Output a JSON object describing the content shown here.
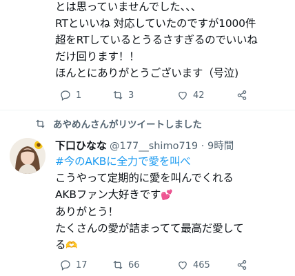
{
  "prev_tweet": {
    "lines": [
      "とは思っていませんでした、、、",
      "RTといいね 対応していたのですが1000件",
      "超をRTしているとうるさすぎるのでいいね",
      "だけ回ります！！",
      "ほんとにありがとうございます（号泣)"
    ],
    "actions": {
      "reply_count": "1",
      "retweet_count": "3",
      "like_count": "42"
    }
  },
  "retweet_header": {
    "text": "あやめんさんがリツイートしました"
  },
  "tweet": {
    "display_name": "下口ひなな",
    "handle_time": "@177__shimo719 · 9時間",
    "hashtag": "#今のAKBに全力で愛を叫べ",
    "line1": "こうやって定期的に愛を叫んでくれる",
    "line2": "AKBファン大好きです",
    "line2_emoji": "💕",
    "line3": "ありがとう！",
    "line4": "たくさんの愛が詰まってて最高だ愛して",
    "line5": "る",
    "line5_emoji": "🫶",
    "actions": {
      "reply_count": "17",
      "retweet_count": "66",
      "like_count": "465"
    }
  },
  "colors": {
    "text": "#0f1419",
    "secondary": "#536471",
    "hashtag": "#1d9bf0",
    "divider": "#eff3f4"
  },
  "icons": [
    "reply-icon",
    "retweet-icon",
    "like-icon",
    "share-icon",
    "sunflower-icon"
  ]
}
